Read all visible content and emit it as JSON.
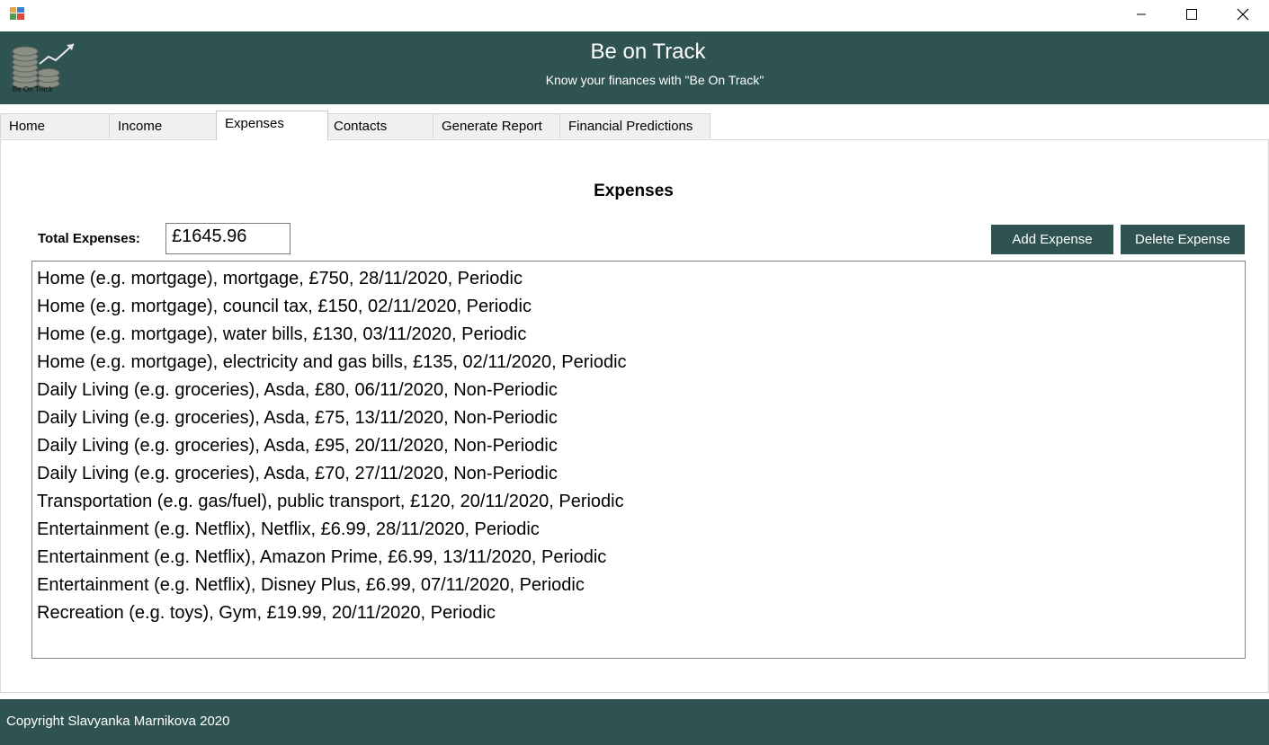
{
  "window": {
    "icon": "app-icon",
    "controls": [
      "minimize-icon",
      "maximize-icon",
      "close-icon"
    ]
  },
  "header": {
    "title": "Be on Track",
    "subtitle": "Know your finances with \"Be On Track\"",
    "logo_text": "Be On Track",
    "background": "#2f5350"
  },
  "tabs": [
    {
      "label": "Home",
      "active": false
    },
    {
      "label": "Income",
      "active": false
    },
    {
      "label": "Expenses",
      "active": true
    },
    {
      "label": "Contacts",
      "active": false
    },
    {
      "label": "Generate Report",
      "active": false
    },
    {
      "label": "Financial Predictions",
      "active": false
    }
  ],
  "expenses": {
    "title": "Expenses",
    "total_label": "Total Expenses:",
    "total_value": "£1645.96",
    "add_button": "Add Expense",
    "delete_button": "Delete Expense",
    "items": [
      "Home (e.g. mortgage), mortgage, £750, 28/11/2020, Periodic",
      "Home (e.g. mortgage), council tax, £150, 02/11/2020, Periodic",
      "Home (e.g. mortgage), water bills, £130, 03/11/2020, Periodic",
      "Home (e.g. mortgage), electricity and gas bills, £135, 02/11/2020, Periodic",
      "Daily Living (e.g. groceries), Asda, £80, 06/11/2020, Non-Periodic",
      "Daily Living (e.g. groceries), Asda, £75, 13/11/2020, Non-Periodic",
      "Daily Living (e.g. groceries), Asda, £95, 20/11/2020, Non-Periodic",
      "Daily Living (e.g. groceries), Asda, £70, 27/11/2020, Non-Periodic",
      "Transportation (e.g. gas/fuel), public transport, £120, 20/11/2020, Periodic",
      "Entertainment (e.g. Netflix), Netflix, £6.99, 28/11/2020, Periodic",
      "Entertainment (e.g. Netflix), Amazon Prime, £6.99, 13/11/2020, Periodic",
      "Entertainment (e.g. Netflix), Disney Plus, £6.99, 07/11/2020, Periodic",
      "Recreation (e.g. toys), Gym, £19.99, 20/11/2020, Periodic"
    ]
  },
  "footer": {
    "text": "Copyright Slavyanka Marnikova 2020"
  }
}
